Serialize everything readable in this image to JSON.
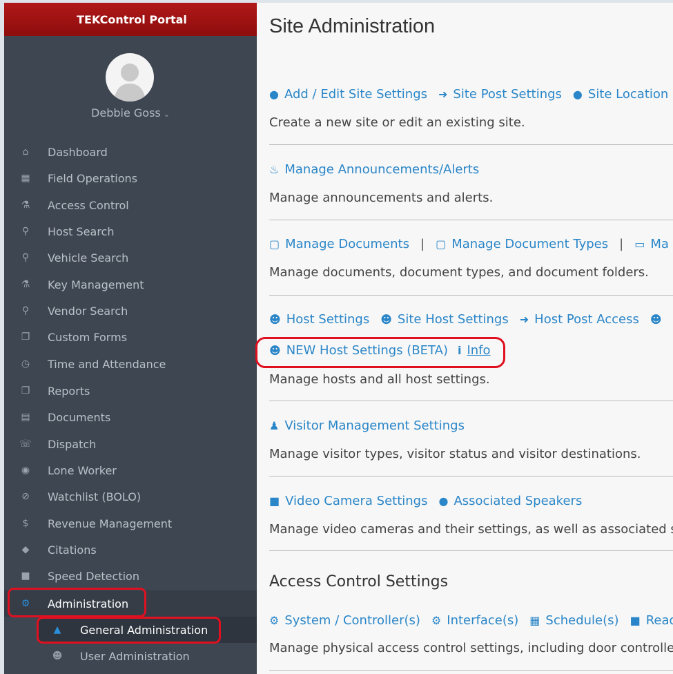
{
  "app": {
    "title": "TEKControl Portal"
  },
  "user": {
    "name": "Debbie Goss"
  },
  "sidebar": {
    "items": [
      {
        "label": "Dashboard",
        "icon": "home-icon"
      },
      {
        "label": "Field Operations",
        "icon": "table-icon"
      },
      {
        "label": "Access Control",
        "icon": "key-icon"
      },
      {
        "label": "Host Search",
        "icon": "search-icon"
      },
      {
        "label": "Vehicle Search",
        "icon": "search-icon"
      },
      {
        "label": "Key Management",
        "icon": "key-icon"
      },
      {
        "label": "Vendor Search",
        "icon": "search-icon"
      },
      {
        "label": "Custom Forms",
        "icon": "copy-icon"
      },
      {
        "label": "Time and Attendance",
        "icon": "clock-icon"
      },
      {
        "label": "Reports",
        "icon": "copy-icon"
      },
      {
        "label": "Documents",
        "icon": "file-icon"
      },
      {
        "label": "Dispatch",
        "icon": "headset-icon"
      },
      {
        "label": "Lone Worker",
        "icon": "eye-icon"
      },
      {
        "label": "Watchlist (BOLO)",
        "icon": "ban-icon"
      },
      {
        "label": "Revenue Management",
        "icon": "dollar-icon"
      },
      {
        "label": "Citations",
        "icon": "ticket-icon"
      },
      {
        "label": "Speed Detection",
        "icon": "video-icon"
      },
      {
        "label": "Administration",
        "icon": "cogs-icon"
      }
    ],
    "sub_items": [
      {
        "label": "General Administration",
        "icon": "sitemap-icon"
      },
      {
        "label": "User Administration",
        "icon": "users-icon"
      }
    ]
  },
  "main": {
    "title": "Site Administration",
    "sections": {
      "site": {
        "links": [
          "Add / Edit Site Settings",
          "Site Post Settings",
          "Site Location Se"
        ],
        "desc": "Create a new site or edit an existing site."
      },
      "announcements": {
        "links": [
          "Manage Announcements/Alerts"
        ],
        "desc": "Manage announcements and alerts."
      },
      "documents": {
        "links": [
          "Manage Documents",
          "Manage Document Types",
          "Ma"
        ],
        "separator": "|",
        "desc": "Manage documents, document types, and document folders."
      },
      "hosts": {
        "links": [
          "Host Settings",
          "Site Host Settings",
          "Host Post Access"
        ],
        "new_link": "NEW Host Settings (BETA)",
        "info_link": "Info",
        "desc": "Manage hosts and all host settings."
      },
      "visitors": {
        "links": [
          "Visitor Management Settings"
        ],
        "desc": "Manage visitor types, visitor status and visitor destinations."
      },
      "video": {
        "links": [
          "Video Camera Settings",
          "Associated Speakers"
        ],
        "desc": "Manage video cameras and their settings, as well as associated spe"
      }
    },
    "access_control": {
      "title": "Access Control Settings",
      "links": [
        "System / Controller(s)",
        "Interface(s)",
        "Schedule(s)",
        "Read"
      ],
      "desc": "Manage physical access control settings, including door controllers"
    }
  },
  "colors": {
    "brand": "#a01010",
    "sidebar_bg": "#3e4651",
    "link": "#2a86c8",
    "highlight": "#e01020"
  }
}
